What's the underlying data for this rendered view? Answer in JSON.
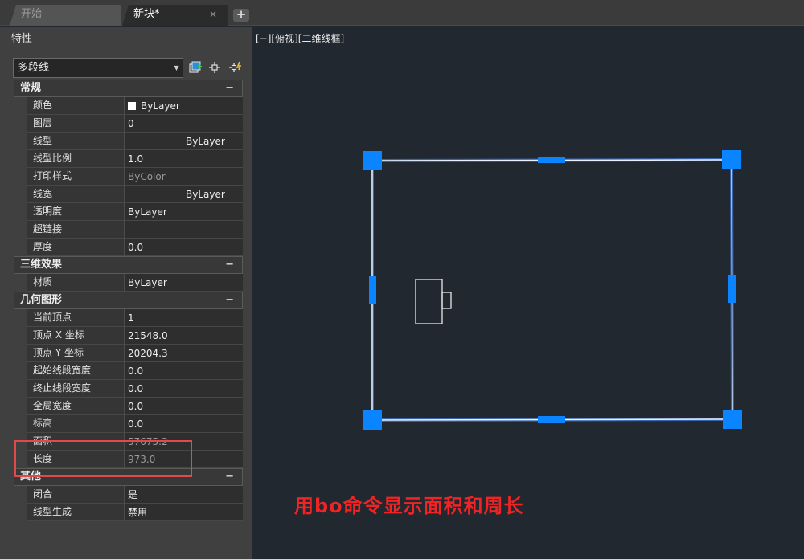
{
  "tabs": [
    {
      "label": "开始",
      "active": false
    },
    {
      "label": "新块*",
      "active": true
    }
  ],
  "tab_close_glyph": "✕",
  "tab_add_glyph": "+",
  "palette": {
    "title": "特性",
    "object_type": "多段线",
    "dropdown_glyph": "▼",
    "tool_icons": [
      "quick-select-icon",
      "select-objects-icon",
      "toggle-pickadd-icon"
    ],
    "sections": [
      {
        "title": "常规",
        "toggle": "−",
        "rows": [
          {
            "label": "颜色",
            "value": "ByLayer",
            "swatch": "#ffffff"
          },
          {
            "label": "图层",
            "value": "0"
          },
          {
            "label": "线型",
            "value": "ByLayer",
            "line": true
          },
          {
            "label": "线型比例",
            "value": "1.0"
          },
          {
            "label": "打印样式",
            "value": "ByColor",
            "dim": true
          },
          {
            "label": "线宽",
            "value": "ByLayer",
            "line": true
          },
          {
            "label": "透明度",
            "value": "ByLayer"
          },
          {
            "label": "超链接",
            "value": ""
          },
          {
            "label": "厚度",
            "value": "0.0"
          }
        ]
      },
      {
        "title": "三维效果",
        "toggle": "−",
        "rows": [
          {
            "label": "材质",
            "value": "ByLayer"
          }
        ]
      },
      {
        "title": "几何图形",
        "toggle": "−",
        "rows": [
          {
            "label": "当前顶点",
            "value": "1"
          },
          {
            "label": "顶点 X 坐标",
            "value": "21548.0"
          },
          {
            "label": "顶点 Y 坐标",
            "value": "20204.3"
          },
          {
            "label": "起始线段宽度",
            "value": "0.0"
          },
          {
            "label": "终止线段宽度",
            "value": "0.0"
          },
          {
            "label": "全局宽度",
            "value": "0.0"
          },
          {
            "label": "标高",
            "value": "0.0"
          },
          {
            "label": "面积",
            "value": "57675.2",
            "dim": true
          },
          {
            "label": "长度",
            "value": "973.0",
            "dim": true
          }
        ]
      },
      {
        "title": "其他",
        "toggle": "−",
        "rows": [
          {
            "label": "闭合",
            "value": "是"
          },
          {
            "label": "线型生成",
            "value": "禁用"
          }
        ]
      }
    ]
  },
  "viewport": {
    "label": "[−][俯视][二维线框]",
    "caption": "用bo命令显示面积和周长",
    "caption_color": "#ef2424",
    "grip_color": "#0a84ff",
    "highlight_color": "#e04a4a"
  }
}
